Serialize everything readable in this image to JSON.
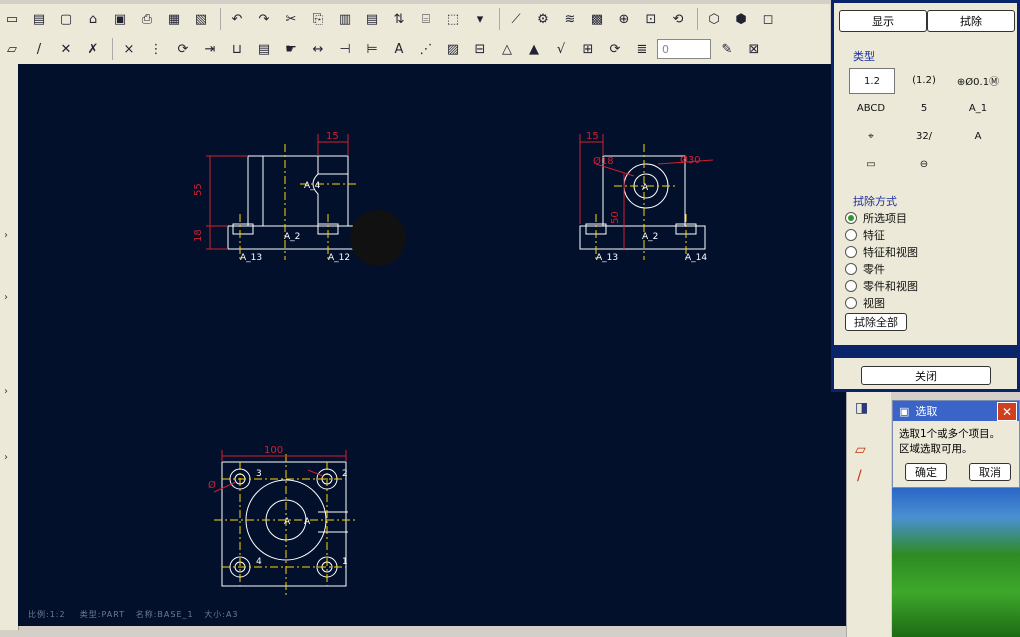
{
  "toolbar": {
    "row1_icons": [
      "new-icon",
      "open-icon",
      "save-icon",
      "print-icon",
      "undo-icon",
      "redo-icon",
      "cut-icon",
      "copy-icon",
      "paste-icon",
      "regen-icon",
      "zoom-in-icon",
      "zoom-fit-icon",
      "spin-icon",
      "view-icon"
    ],
    "row2_icons": [
      "datum-plane-icon",
      "axis-icon",
      "point-icon",
      "csys-icon",
      "delete-icon",
      "dimension-icon",
      "note-icon",
      "table-icon",
      "layer-icon",
      "select-icon"
    ],
    "combo_value": "0"
  },
  "panel": {
    "tabs": {
      "show": "显示",
      "erase": "拭除"
    },
    "type_title": "类型",
    "type_symbols": [
      "1.2",
      "(1.2)",
      "⊕Ø0.1Ⓜ",
      "ABCD",
      "5",
      "A_1",
      "32/",
      "A"
    ],
    "erase_mode_title": "拭除方式",
    "radios": [
      "所选项目",
      "特征",
      "特征和视图",
      "零件",
      "零件和视图",
      "视图"
    ],
    "selected_radio": 0,
    "erase_all": "拭除全部",
    "close": "关闭"
  },
  "select_dialog": {
    "title": "选取",
    "line1": "选取1个或多个项目。",
    "line2": "区域选取可用。",
    "ok": "确定",
    "cancel": "取消"
  },
  "drawing": {
    "front_labels": [
      "15",
      "55",
      "18",
      "A_4",
      "A_2",
      "A_13",
      "A_12"
    ],
    "side_labels": [
      "15",
      "Ø18",
      "Ø30",
      "A",
      "50",
      "A_2",
      "A_13",
      "A_14"
    ],
    "top_labels": [
      "100",
      "3",
      "2",
      "4",
      "1",
      "Ø",
      "A",
      "A"
    ]
  },
  "status": {
    "scale": "比例:1:2",
    "type": "类型:PART",
    "name": "名称:BASE_1",
    "size": "大小:A3"
  },
  "colors": {
    "canvas": "#02102c",
    "geometry": "#ffffff",
    "dimension": "#d02030",
    "centerline": "#ffd400"
  }
}
